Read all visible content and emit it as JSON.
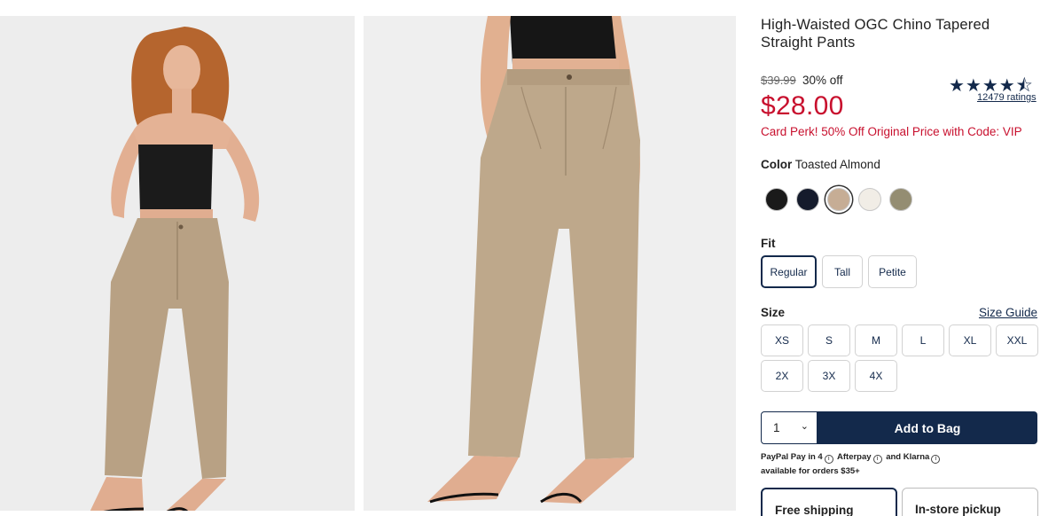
{
  "product": {
    "title": "High-Waisted OGC Chino Tapered Straight Pants",
    "original_price": "$39.99",
    "discount": "30% off",
    "sale_price": "$28.00",
    "rating_stars": "★★★★⯪",
    "rating": 4.5,
    "ratings_count": "12479 ratings",
    "promo": "Card Perk! 50% Off Original Price with Code: VIP"
  },
  "color": {
    "label": "Color",
    "selected": "Toasted Almond",
    "swatches": [
      {
        "name": "black",
        "hex": "#1a1a1a"
      },
      {
        "name": "navy",
        "hex": "#151b2c"
      },
      {
        "name": "toasted-almond",
        "hex": "#c6ad95",
        "selected": true
      },
      {
        "name": "cream",
        "hex": "#f1ede6"
      },
      {
        "name": "olive-khaki",
        "hex": "#948d72"
      }
    ]
  },
  "fit": {
    "label": "Fit",
    "options": [
      "Regular",
      "Tall",
      "Petite"
    ],
    "selected": "Regular"
  },
  "size": {
    "label": "Size",
    "guide_link": "Size Guide",
    "options": [
      "XS",
      "S",
      "M",
      "L",
      "XL",
      "XXL",
      "2X",
      "3X",
      "4X"
    ]
  },
  "cart": {
    "quantity": "1",
    "add_label": "Add to Bag"
  },
  "payment": {
    "paypal": "PayPal Pay in 4",
    "afterpay": "Afterpay",
    "klarna": "and Klarna",
    "note": "available for orders $35+"
  },
  "shipping": {
    "free": "Free shipping",
    "pickup": "In-store pickup"
  },
  "colors": {
    "brand_navy": "#13294b",
    "sale_red": "#c8102e"
  }
}
